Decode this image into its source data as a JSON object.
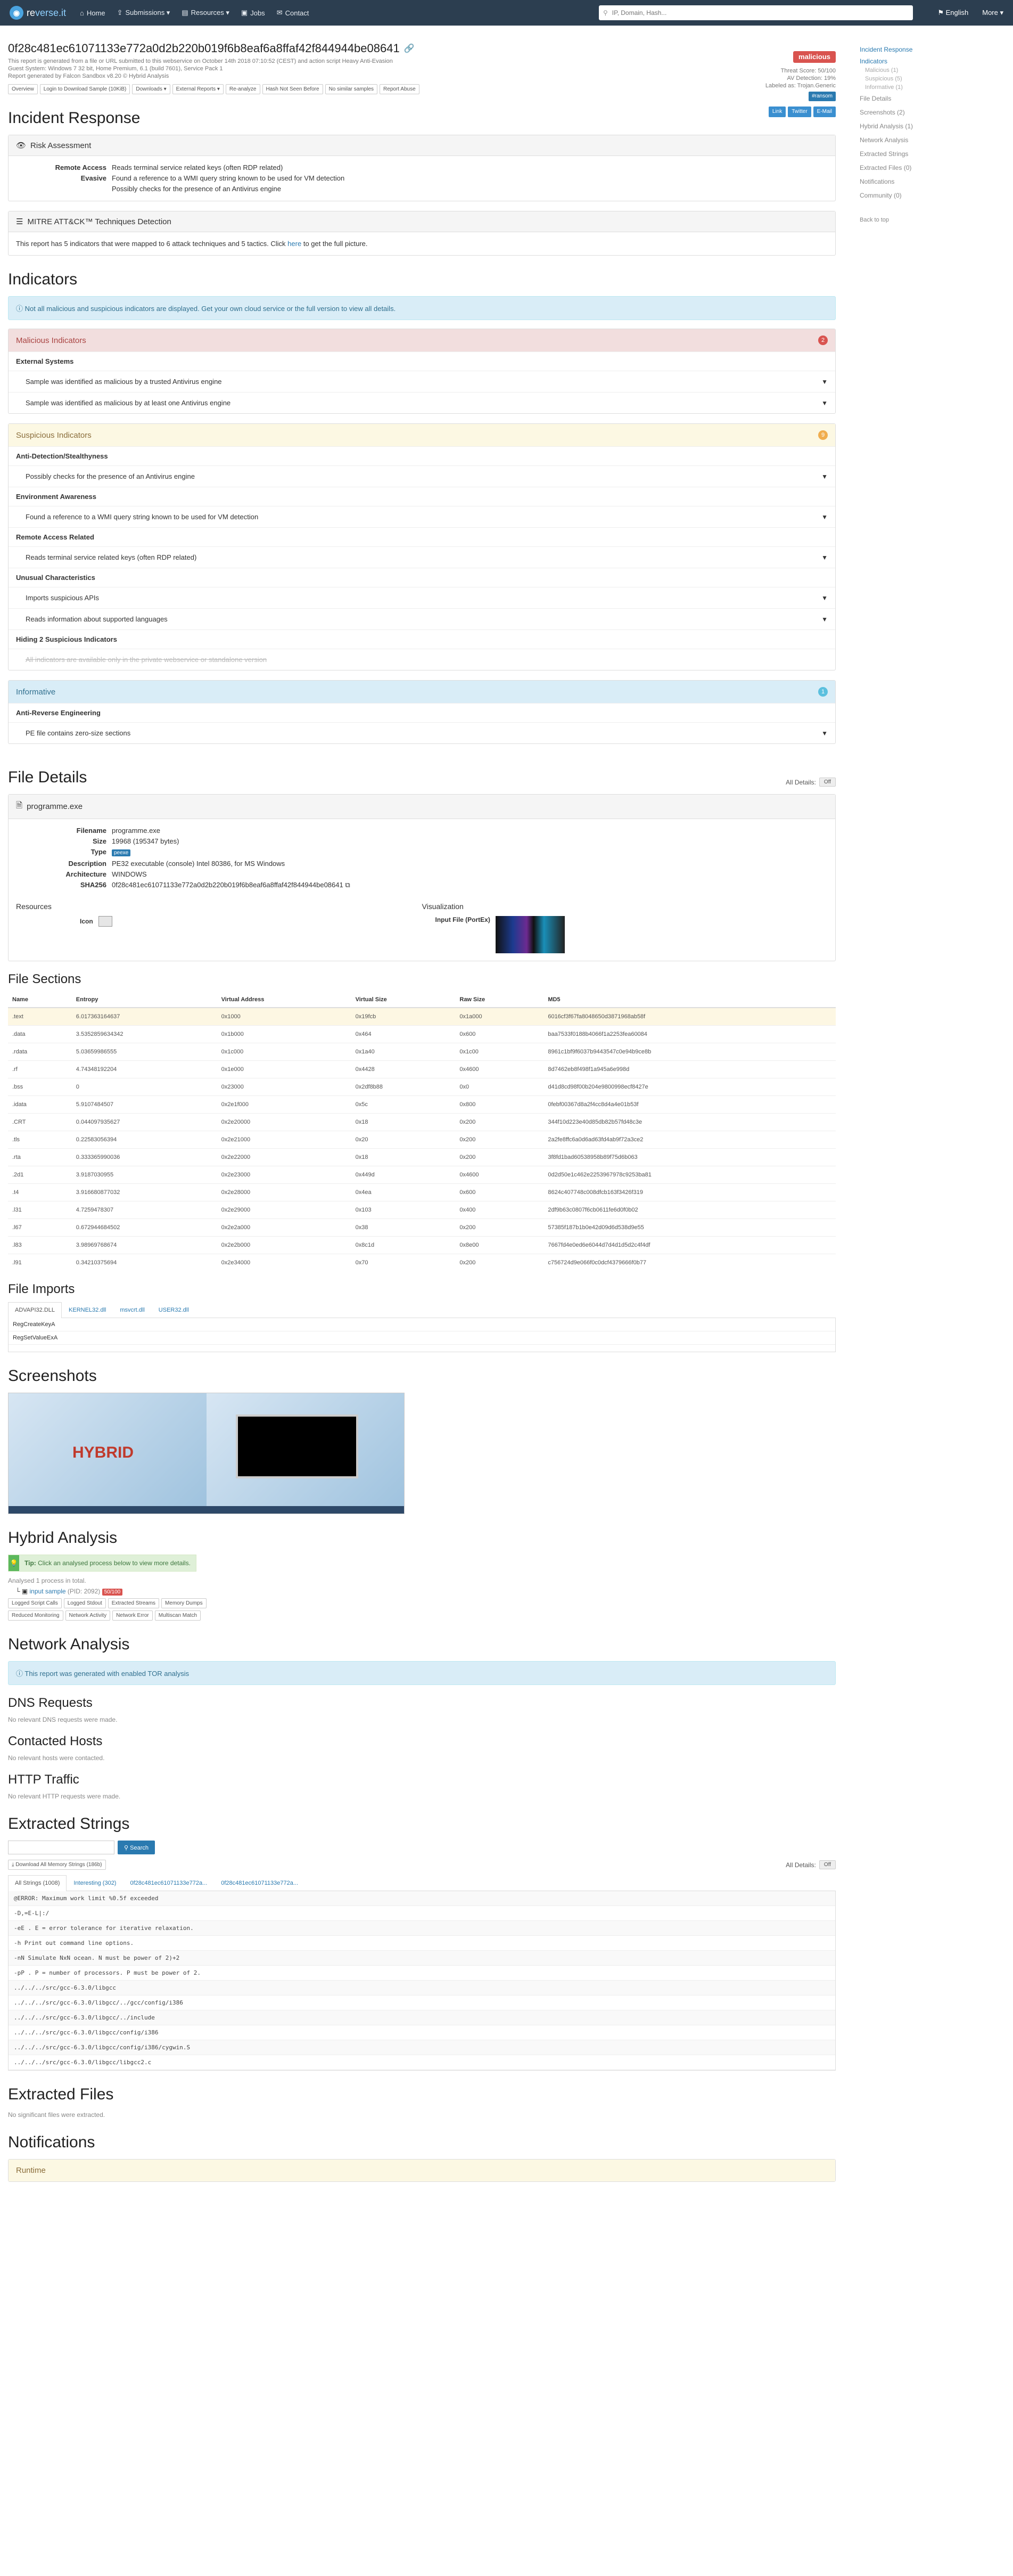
{
  "nav": {
    "brand_prefix": "re",
    "brand_name": "verse.it",
    "links": [
      "Home",
      "Submissions ▾",
      "Resources ▾",
      "Jobs",
      "Contact"
    ],
    "search_placeholder": "IP, Domain, Hash...",
    "language": "English",
    "more": "More ▾"
  },
  "report": {
    "hash": "0f28c481ec61071133e772a0d2b220b019f6b8eaf6a8ffaf42f844944be08641",
    "meta": [
      "This report is generated from a file or URL submitted to this webservice on October 14th 2018 07:10:52 (CEST) and action script Heavy Anti-Evasion",
      "Guest System: Windows 7 32 bit, Home Premium, 6.1 (build 7601), Service Pack 1",
      "Report generated by Falcon Sandbox v8.20 © Hybrid Analysis"
    ],
    "toolbar": [
      "Overview",
      "Login to Download Sample (10KiB)",
      "Downloads ▾",
      "External Reports ▾",
      "Re-analyze",
      "Hash Not Seen Before",
      "No similar samples",
      "Report Abuse"
    ],
    "verdict": "malicious",
    "threat_score": "Threat Score: 50/100",
    "av_detection": "AV Detection: 19%",
    "labeled": "Labeled as: Trojan.Generic",
    "label_badge": "#ransom",
    "share": [
      "Link",
      "Twitter",
      "E-Mail"
    ]
  },
  "sidebar": {
    "items": [
      "Incident Response",
      "Indicators",
      "Malicious (1)",
      "Suspicious (5)",
      "Informative (1)",
      "File Details",
      "Screenshots (2)",
      "Hybrid Analysis (1)",
      "Network Analysis",
      "Extracted Strings",
      "Extracted Files (0)",
      "Notifications",
      "Community (0)",
      "Back to top"
    ]
  },
  "incident": {
    "title": "Incident Response",
    "risk_title": "Risk Assessment",
    "risk": [
      {
        "k": "Remote Access",
        "v": [
          "Reads terminal service related keys (often RDP related)"
        ]
      },
      {
        "k": "Evasive",
        "v": [
          "Found a reference to a WMI query string known to be used for VM detection",
          "Possibly checks for the presence of an Antivirus engine"
        ]
      }
    ],
    "mitre_title": "MITRE ATT&CK™ Techniques Detection",
    "mitre_text": "This report has 5 indicators that were mapped to 6 attack techniques and 5 tactics. Click",
    "mitre_link": "here",
    "mitre_tail": "to get the full picture."
  },
  "indicators": {
    "title": "Indicators",
    "notice": "Not all malicious and suspicious indicators are displayed. Get your own cloud service or the full version to view all details.",
    "malicious": {
      "title": "Malicious Indicators",
      "count": "2",
      "groups": [
        {
          "name": "External Systems",
          "items": [
            "Sample was identified as malicious by a trusted Antivirus engine",
            "Sample was identified as malicious by at least one Antivirus engine"
          ]
        }
      ]
    },
    "suspicious": {
      "title": "Suspicious Indicators",
      "count": "9",
      "groups": [
        {
          "name": "Anti-Detection/Stealthyness",
          "items": [
            "Possibly checks for the presence of an Antivirus engine"
          ]
        },
        {
          "name": "Environment Awareness",
          "items": [
            "Found a reference to a WMI query string known to be used for VM detection"
          ]
        },
        {
          "name": "Remote Access Related",
          "items": [
            "Reads terminal service related keys (often RDP related)"
          ]
        },
        {
          "name": "Unusual Characteristics",
          "items": [
            "Imports suspicious APIs",
            "Reads information about supported languages"
          ]
        }
      ],
      "hidden": "Hiding 2 Suspicious Indicators",
      "hidden_note": "All indicators are available only in the private webservice or standalone version"
    },
    "informative": {
      "title": "Informative",
      "count": "1",
      "groups": [
        {
          "name": "Anti-Reverse Engineering",
          "items": [
            "PE file contains zero-size sections"
          ]
        }
      ]
    }
  },
  "file": {
    "title": "File Details",
    "all_details": "All Details:",
    "toggle": "Off",
    "name": "programme.exe",
    "rows": [
      {
        "k": "Filename",
        "v": "programme.exe"
      },
      {
        "k": "Size",
        "v": "19968 (195347 bytes)"
      },
      {
        "k": "Type",
        "v": "peexe"
      },
      {
        "k": "Description",
        "v": "PE32 executable (console) Intel 80386, for MS Windows"
      },
      {
        "k": "Architecture",
        "v": "WINDOWS"
      },
      {
        "k": "SHA256",
        "v": "0f28c481ec61071133e772a0d2b220b019f6b8eaf6a8ffaf42f844944be08641"
      }
    ],
    "resources": "Resources",
    "icon_label": "Icon",
    "visualization": "Visualization",
    "input_file": "Input File (PortEx)"
  },
  "sections": {
    "title": "File Sections",
    "headers": [
      "Name",
      "Entropy",
      "Virtual Address",
      "Virtual Size",
      "Raw Size",
      "MD5"
    ],
    "rows": [
      [
        ".text",
        "6.017363164637",
        "0x1000",
        "0x19fcb",
        "0x1a000",
        "6016cf3f67fa8048650d3871968ab58f"
      ],
      [
        ".data",
        "3.5352859634342",
        "0x1b000",
        "0x464",
        "0x600",
        "baa7533f0188b4066f1a2253fea60084"
      ],
      [
        ".rdata",
        "5.03659986555",
        "0x1c000",
        "0x1a40",
        "0x1c00",
        "8961c1bf9f6037b9443547c0e94b9ce8b"
      ],
      [
        ".rf",
        "4.74348192204",
        "0x1e000",
        "0x4428",
        "0x4600",
        "8d7462eb8f498f1a945a6e998d"
      ],
      [
        ".bss",
        "0",
        "0x23000",
        "0x2df8b88",
        "0x0",
        "d41d8cd98f00b204e9800998ecf8427e"
      ],
      [
        ".idata",
        "5.9107484507",
        "0x2e1f000",
        "0x5c",
        "0x800",
        "0febf00367d8a2f4cc8d4a4e01b53f"
      ],
      [
        ".CRT",
        "0.044097935627",
        "0x2e20000",
        "0x18",
        "0x200",
        "344f10d223e40d85db82b57fd48c3e"
      ],
      [
        ".tls",
        "0.22583056394",
        "0x2e21000",
        "0x20",
        "0x200",
        "2a2fe8ffc6a0d6ad63fd4ab9f72a3ce2"
      ],
      [
        ".rta",
        "0.333365990036",
        "0x2e22000",
        "0x18",
        "0x200",
        "3f8fd1bad60538958b89f75d6b063"
      ],
      [
        ".2d1",
        "3.9187030955",
        "0x2e23000",
        "0x449d",
        "0x4600",
        "0d2d50e1c462e2253967978c9253ba81"
      ],
      [
        ".t4",
        "3.916680877032",
        "0x2e28000",
        "0x4ea",
        "0x600",
        "8624c407748c008dfcb163f3426f319"
      ],
      [
        ".l31",
        "4.7259478307",
        "0x2e29000",
        "0x103",
        "0x400",
        "2df9b63c0807f6cb0611fe6d0f0b02"
      ],
      [
        ".l67",
        "0.672944684502",
        "0x2e2a000",
        "0x38",
        "0x200",
        "57385f187b1b0e42d09d6d538d9e55"
      ],
      [
        ".l83",
        "3.98969768674",
        "0x2e2b000",
        "0x8c1d",
        "0x8e00",
        "7667fd4e0ed6e6044d7d4d1d5d2c4f4df"
      ],
      [
        ".l91",
        "0.34210375694",
        "0x2e34000",
        "0x70",
        "0x200",
        "c756724d9e066f0c0dcf4379666f0b77"
      ]
    ]
  },
  "imports": {
    "title": "File Imports",
    "tabs": [
      "ADVAPI32.DLL",
      "KERNEL32.dll",
      "msvcrt.dll",
      "USER32.dll"
    ],
    "items": [
      "RegCreateKeyA",
      "RegSetValueExA"
    ]
  },
  "screenshots": {
    "title": "Screenshots",
    "logo": "HYBRID"
  },
  "hybrid": {
    "title": "Hybrid Analysis",
    "tip_label": "Tip:",
    "tip": "Click an analysed process below to view more details.",
    "analysed": "Analysed 1 process in total.",
    "process_name": "input sample",
    "process_meta": "(PID: 2092)",
    "process_badge": "50/100",
    "chips": [
      "Logged Script Calls",
      "Logged Stdout",
      "Extracted Streams",
      "Memory Dumps",
      "Reduced Monitoring",
      "Network Activity",
      "Network Error",
      "Multiscan Match"
    ]
  },
  "network": {
    "title": "Network Analysis",
    "tor": "This report was generated with enabled TOR analysis",
    "dns_title": "DNS Requests",
    "dns": "No relevant DNS requests were made.",
    "hosts_title": "Contacted Hosts",
    "hosts": "No relevant hosts were contacted.",
    "http_title": "HTTP Traffic",
    "http": "No relevant HTTP requests were made."
  },
  "strings": {
    "title": "Extracted Strings",
    "search_btn": "Search",
    "download": "Download All Memory Strings (186b)",
    "all_details": "All Details:",
    "toggle": "Off",
    "tabs": [
      "All Strings (1008)",
      "Interesting (302)",
      "0f28c481ec61071133e772a...",
      "0f28c481ec61071133e772a..."
    ],
    "items": [
      "@ERROR: Maximum work limit %0.5f exceeded",
      "-D,=E-L|:/",
      "-eE . E = error tolerance for iterative relaxation.",
      "-h Print out command line options.",
      "-nN Simulate NxN ocean. N must be power of 2)+2",
      "-pP . P = number of processors. P must be power of 2.",
      "../../../src/gcc-6.3.0/libgcc",
      "../../../src/gcc-6.3.0/libgcc/../gcc/config/i386",
      "../../../src/gcc-6.3.0/libgcc/../include",
      "../../../src/gcc-6.3.0/libgcc/config/i386",
      "../../../src/gcc-6.3.0/libgcc/config/i386/cygwin.S",
      "../../../src/gcc-6.3.0/libgcc/libgcc2.c"
    ]
  },
  "extracted": {
    "title": "Extracted Files",
    "text": "No significant files were extracted."
  },
  "notifications": {
    "title": "Notifications",
    "runtime": "Runtime"
  }
}
